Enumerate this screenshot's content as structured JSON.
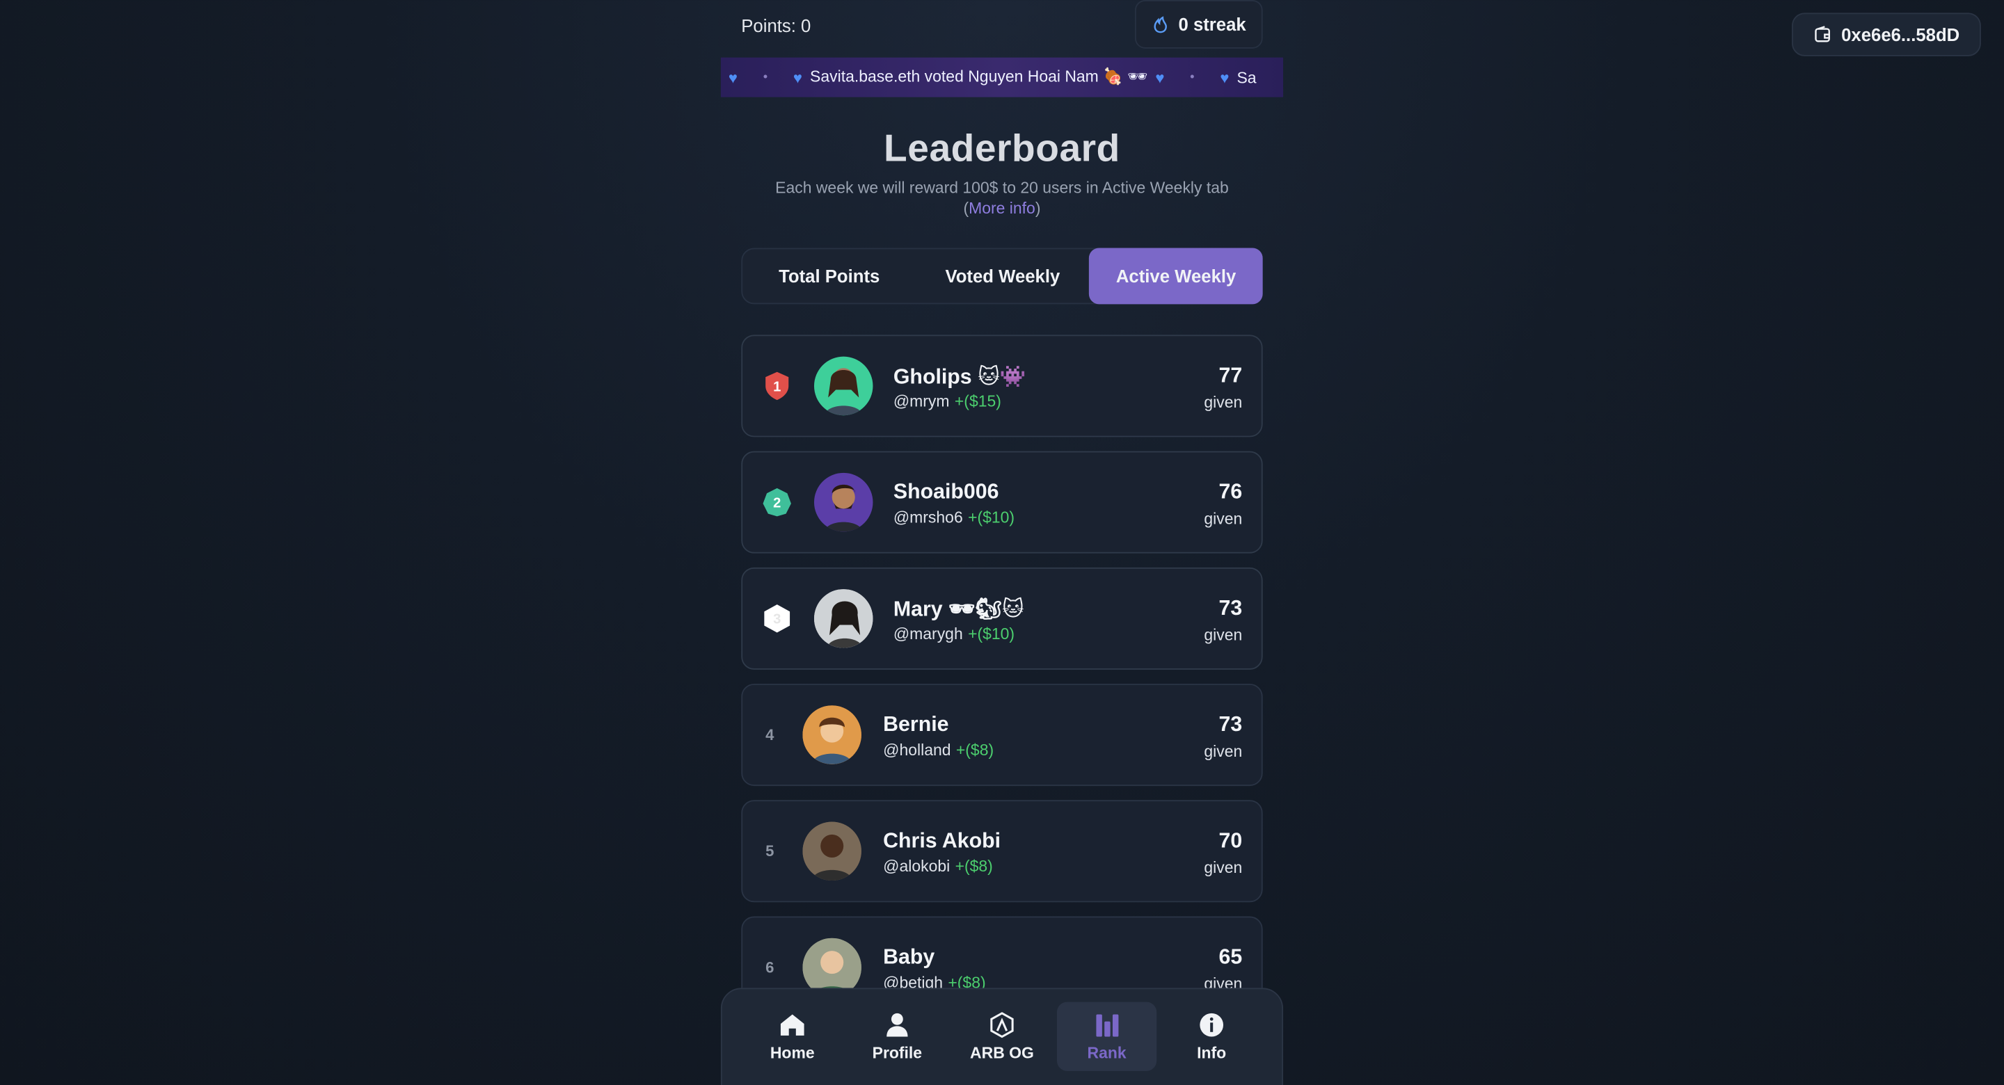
{
  "wallet": {
    "address": "0xe6e6...58dD",
    "icon": "wallet-icon"
  },
  "header": {
    "points_label": "Points: 0",
    "streak_label": "0 streak",
    "streak_icon": "flame-icon"
  },
  "ticker": {
    "message": "Savita.base.eth voted Nguyen Hoai Nam 🍖 🕶",
    "trailing": "Sa"
  },
  "page": {
    "title": "Leaderboard",
    "subtitle": "Each week we will reward 100$ to 20 users in Active Weekly tab (",
    "more_info": "More info",
    "subtitle_end": ")"
  },
  "tabs": [
    {
      "label": "Total Points",
      "active": false
    },
    {
      "label": "Voted Weekly",
      "active": false
    },
    {
      "label": "Active Weekly",
      "active": true
    }
  ],
  "leaderboard": [
    {
      "rank": "1",
      "name": "Gholips 🐱👾",
      "handle": "@mrym",
      "reward": "+($15)",
      "score": "77",
      "score_label": "given"
    },
    {
      "rank": "2",
      "name": "Shoaib006",
      "handle": "@mrsho6",
      "reward": "+($10)",
      "score": "76",
      "score_label": "given"
    },
    {
      "rank": "3",
      "name": "Mary 🕶🐿🐱",
      "handle": "@marygh",
      "reward": "+($10)",
      "score": "73",
      "score_label": "given"
    },
    {
      "rank": "4",
      "name": "Bernie",
      "handle": "@holland",
      "reward": "+($8)",
      "score": "73",
      "score_label": "given"
    },
    {
      "rank": "5",
      "name": "Chris Akobi",
      "handle": "@alokobi",
      "reward": "+($8)",
      "score": "70",
      "score_label": "given"
    },
    {
      "rank": "6",
      "name": "Baby",
      "handle": "@betigh",
      "reward": "+($8)",
      "score": "65",
      "score_label": "given"
    }
  ],
  "nav": [
    {
      "label": "Home",
      "icon": "home-icon",
      "active": false
    },
    {
      "label": "Profile",
      "icon": "person-icon",
      "active": false
    },
    {
      "label": "ARB OG",
      "icon": "arbitrum-icon",
      "active": false
    },
    {
      "label": "Rank",
      "icon": "bar-chart-icon",
      "active": true
    },
    {
      "label": "Info",
      "icon": "info-icon",
      "active": false
    }
  ],
  "colors": {
    "accent": "#7b68c8",
    "reward": "#4ccf6e",
    "background": "#141c28",
    "card": "#1a2230",
    "rank1": "#e0504a",
    "rank2": "#3fbf9a",
    "rank3": "#ffffff"
  }
}
